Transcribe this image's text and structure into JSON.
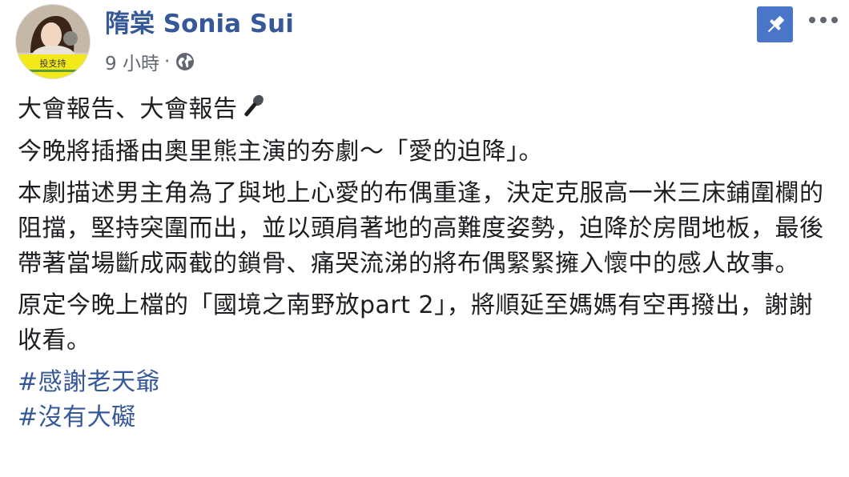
{
  "post": {
    "author": "隋棠 Sonia Sui",
    "time": "9 小時",
    "separator": "·",
    "privacy_icon": "globe-icon",
    "pin_icon": "pin-icon",
    "more_icon": "more-options-icon",
    "avatar_badge_text": "投支持",
    "paragraphs": [
      "大會報告、大會報告",
      "今晚將插播由奧里熊主演的夯劇～「愛的迫降」。",
      "本劇描述男主角為了與地上心愛的布偶重逢，決定克服高一米三床鋪圍欄的阻擋，堅持突圍而出，並以頭肩著地的高難度姿勢，迫降於房間地板，最後帶著當場斷成兩截的鎖骨、痛哭流涕的將布偶緊緊擁入懷中的感人故事。",
      "原定今晚上檔的「國境之南野放part 2」，將順延至媽媽有空再撥出，謝謝收看。"
    ],
    "hashtags": [
      "#感謝老天爺",
      "#沒有大礙"
    ],
    "colors": {
      "link": "#365899",
      "text": "#1c1e21",
      "meta": "#616770",
      "pin_bg": "#4a76c9"
    }
  }
}
